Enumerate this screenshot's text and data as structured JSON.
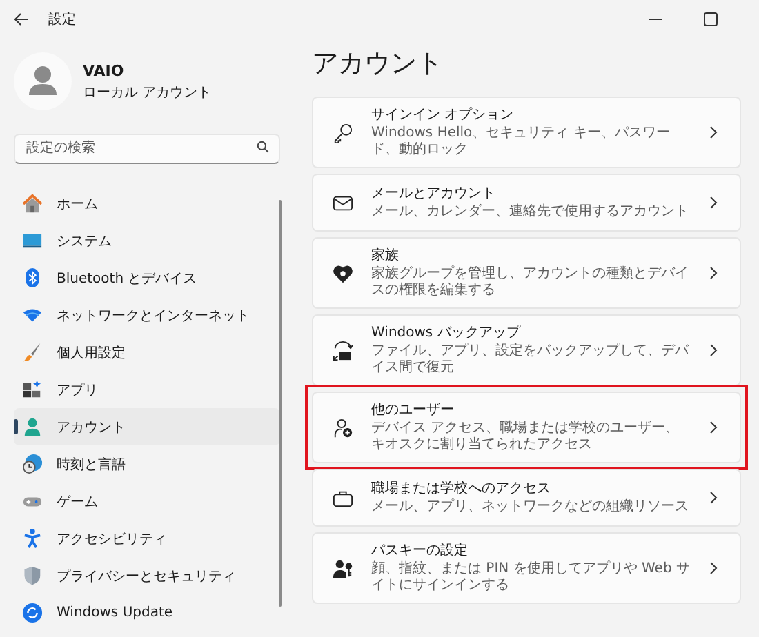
{
  "window": {
    "title": "設定"
  },
  "profile": {
    "name": "VAIO",
    "account_type": "ローカル アカウント"
  },
  "search": {
    "placeholder": "設定の検索"
  },
  "nav": [
    {
      "kind": "home",
      "label": "ホーム",
      "selected": false
    },
    {
      "kind": "system",
      "label": "システム",
      "selected": false
    },
    {
      "kind": "bluetooth",
      "label": "Bluetooth とデバイス",
      "selected": false
    },
    {
      "kind": "network",
      "label": "ネットワークとインターネット",
      "selected": false
    },
    {
      "kind": "personalize",
      "label": "個人用設定",
      "selected": false
    },
    {
      "kind": "apps",
      "label": "アプリ",
      "selected": false
    },
    {
      "kind": "accounts",
      "label": "アカウント",
      "selected": true
    },
    {
      "kind": "time",
      "label": "時刻と言語",
      "selected": false
    },
    {
      "kind": "gaming",
      "label": "ゲーム",
      "selected": false
    },
    {
      "kind": "accessibility",
      "label": "アクセシビリティ",
      "selected": false
    },
    {
      "kind": "privacy",
      "label": "プライバシーとセキュリティ",
      "selected": false
    },
    {
      "kind": "update",
      "label": "Windows Update",
      "selected": false
    }
  ],
  "page": {
    "title": "アカウント"
  },
  "cards": [
    {
      "kind": "key",
      "title": "サインイン オプション",
      "description": "Windows Hello、セキュリティ キー、パスワード、動的ロック",
      "highlighted": false
    },
    {
      "kind": "mail",
      "title": "メールとアカウント",
      "description": "メール、カレンダー、連絡先で使用するアカウント",
      "highlighted": false
    },
    {
      "kind": "family",
      "title": "家族",
      "description": "家族グループを管理し、アカウントの種類とデバイスの権限を編集する",
      "highlighted": false
    },
    {
      "kind": "backup",
      "title": "Windows バックアップ",
      "description": "ファイル、アプリ、設定をバックアップして、デバイス間で復元",
      "highlighted": false
    },
    {
      "kind": "users",
      "title": "他のユーザー",
      "description": "デバイス アクセス、職場または学校のユーザー、キオスクに割り当てられたアクセス",
      "highlighted": true
    },
    {
      "kind": "work",
      "title": "職場または学校へのアクセス",
      "description": "メール、アプリ、ネットワークなどの組織リソース",
      "highlighted": false
    },
    {
      "kind": "passkey",
      "title": "パスキーの設定",
      "description": "顔、指紋、または PIN を使用してアプリや Web サイトにサインインする",
      "highlighted": false
    }
  ]
}
